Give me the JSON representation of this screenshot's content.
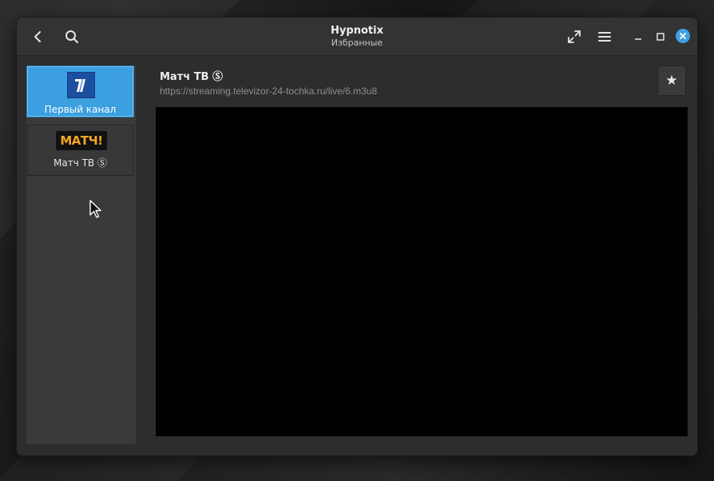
{
  "window": {
    "title": "Hypnotix",
    "subtitle": "Избранные"
  },
  "header": {
    "back_icon": "chevron-left-icon",
    "search_icon": "search-icon",
    "fullscreen_icon": "expand-icon",
    "menu_icon": "hamburger-menu-icon",
    "minimize_icon": "minimize-icon",
    "maximize_icon": "maximize-icon",
    "close_icon": "close-icon",
    "close_color": "#3da1e2"
  },
  "sidebar": {
    "channels": [
      {
        "label": "Первый канал",
        "logo_text": "1",
        "selected": true
      },
      {
        "label": "Матч ТВ Ⓢ",
        "logo_text": "МАТЧ!",
        "selected": false
      }
    ],
    "selected_color": "#3b9fe0"
  },
  "main": {
    "channel_title": "Матч ТВ Ⓢ",
    "stream_url": "https://streaming.televizor-24-tochka.ru/live/6.m3u8",
    "favorite_glyph": "★"
  }
}
